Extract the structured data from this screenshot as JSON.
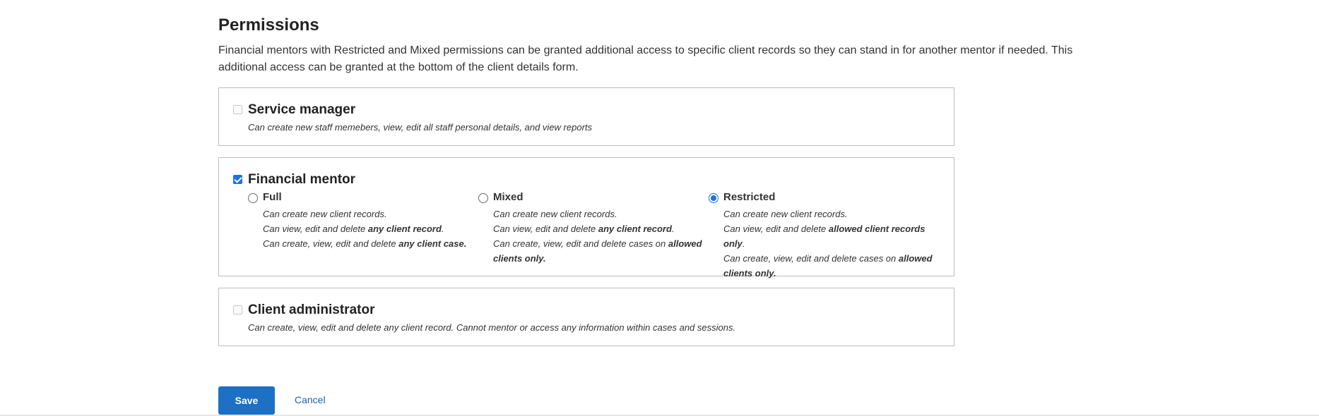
{
  "page": {
    "title": "Permissions",
    "intro": "Financial mentors with Restricted and Mixed permissions can be granted additional access to specific client records so they can stand in for another mentor if needed. This additional access can be granted at the bottom of the client details form."
  },
  "roles": {
    "service_manager": {
      "title": "Service manager",
      "description": "Can create new staff memebers, view, edit all staff personal details, and view reports",
      "checked": false
    },
    "financial_mentor": {
      "title": "Financial mentor",
      "checked": true,
      "selected_option": "Restricted",
      "options": {
        "full": {
          "label": "Full",
          "line1": "Can create new client records.",
          "line2_pre": "Can view, edit and delete ",
          "line2_bold": "any client record",
          "line2_post": ".",
          "line3_pre": "Can create, view, edit and delete ",
          "line3_bold": "any client case."
        },
        "mixed": {
          "label": "Mixed",
          "line1": "Can create new client records.",
          "line2_pre": "Can view, edit and delete ",
          "line2_bold": "any client record",
          "line2_post": ".",
          "line3_pre": "Can create, view, edit and delete cases on ",
          "line3_bold": "allowed clients only."
        },
        "restricted": {
          "label": "Restricted",
          "line1": "Can create new client records.",
          "line2_pre": "Can view, edit and delete ",
          "line2_bold": "allowed client records only",
          "line2_post": ".",
          "line3_pre": "Can create, view, edit and delete cases on ",
          "line3_bold": "allowed clients only."
        }
      }
    },
    "client_administrator": {
      "title": "Client administrator",
      "description": "Can create, view, edit and delete any client record. Cannot mentor or access any information within cases and sessions.",
      "checked": false
    }
  },
  "actions": {
    "save_label": "Save",
    "cancel_label": "Cancel"
  },
  "colors": {
    "accent": "#1d70c4",
    "link": "#1d5fb3",
    "border": "#bdbdbd"
  }
}
